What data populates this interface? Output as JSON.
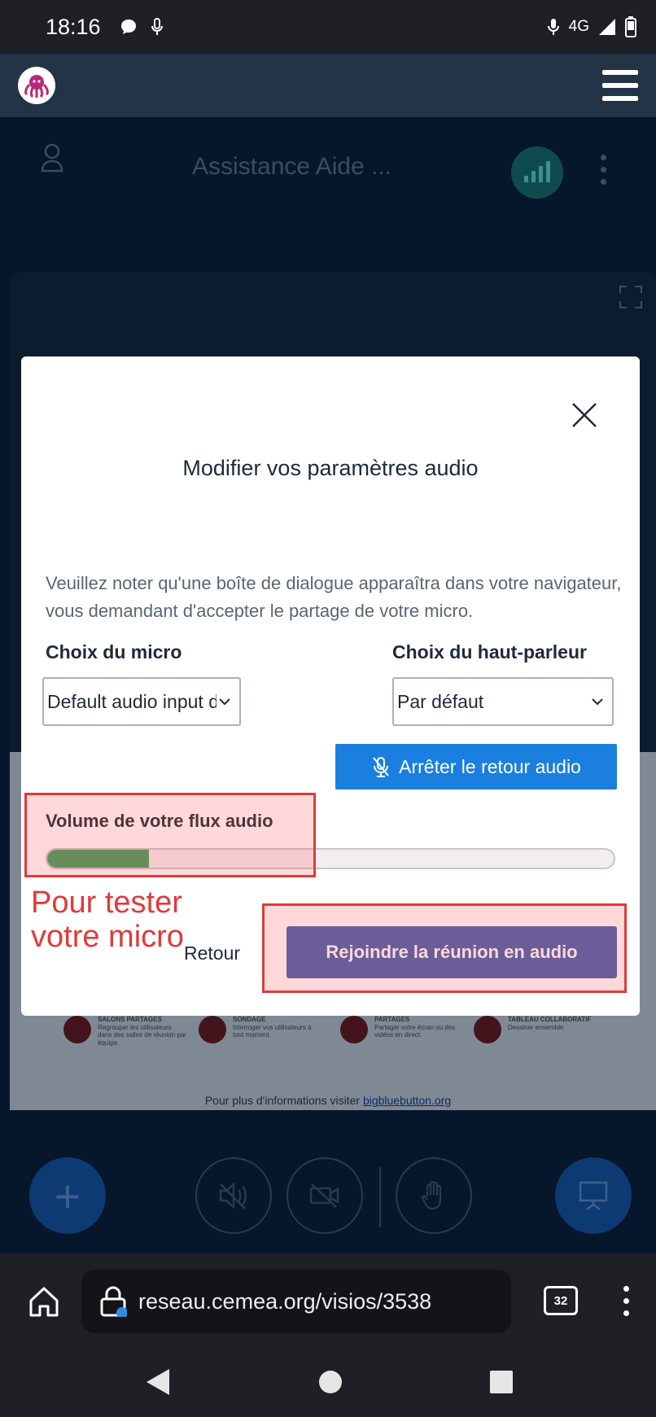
{
  "status_bar": {
    "time": "18:16",
    "network": "4G"
  },
  "meeting": {
    "title": "Assistance Aide ...",
    "features": [
      {
        "title": "SALONS PARTAGES",
        "desc": "Regrouper les utilisateurs dans des salles de réunion par équipe."
      },
      {
        "title": "SONDAGE",
        "desc": "Interroger vos utilisateurs à tout moment."
      },
      {
        "title": "PARTAGES",
        "desc": "Partager votre écran ou des vidéos en direct."
      },
      {
        "title": "TABLEAU COLLABORATIF",
        "desc": "Dessiner ensemble."
      }
    ],
    "footer_text": "Pour plus d'informations visiter ",
    "footer_link": "bigbluebutton.org"
  },
  "modal": {
    "title": "Modifier vos paramètres audio",
    "notice": "Veuillez noter qu'une boîte de dialogue apparaîtra dans votre navigateur, vous demandant d'accepter le partage de votre micro.",
    "mic_label": "Choix du micro",
    "mic_value": "Default audio input device",
    "speaker_label": "Choix du haut-parleur",
    "speaker_value": "Par défaut",
    "stop_feedback_label": "Arrêter le retour audio",
    "volume_label": "Volume de votre flux audio",
    "volume_level": 0.18,
    "back_label": "Retour",
    "join_label": "Rejoindre la réunion en audio"
  },
  "annotation": {
    "text": "Pour tester votre micro",
    "color": "#e03a3a"
  },
  "browser": {
    "url": "reseau.cemea.org/visios/3538",
    "tab_count": "32"
  },
  "colors": {
    "primary_blue": "#1b7fe0",
    "join_blue": "#4261ad",
    "volume_green": "#3f9d5e"
  }
}
